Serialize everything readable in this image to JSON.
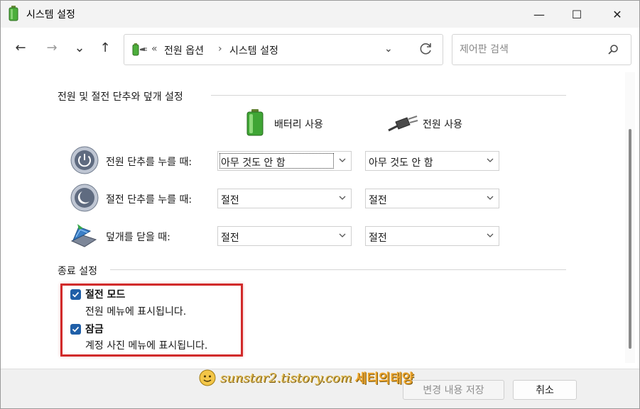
{
  "window": {
    "title": "시스템 설정",
    "minimize_glyph": "—",
    "maximize_glyph": "☐",
    "close_glyph": "✕"
  },
  "nav": {
    "back_glyph": "←",
    "forward_glyph": "→",
    "recent_glyph": "⌄",
    "up_glyph": "↑",
    "address": {
      "overflow": "«",
      "crumbs": [
        "전원 옵션",
        "시스템 설정"
      ],
      "separator": "›",
      "dropdown_glyph": "⌄"
    },
    "search": {
      "placeholder": "제어판 검색"
    }
  },
  "power_buttons_section": {
    "heading": "전원 및 절전 단추와 덮개 설정",
    "columns": {
      "battery": "배터리 사용",
      "plugged": "전원 사용"
    },
    "rows": [
      {
        "label": "전원 단추를 누를 때:",
        "battery": "아무 것도 안 함",
        "plugged": "아무 것도 안 함",
        "icon": "power-button-icon"
      },
      {
        "label": "절전 단추를 누를 때:",
        "battery": "절전",
        "plugged": "절전",
        "icon": "sleep-button-icon"
      },
      {
        "label": "덮개를 닫을 때:",
        "battery": "절전",
        "plugged": "절전",
        "icon": "laptop-lid-icon"
      }
    ]
  },
  "shutdown_section": {
    "heading": "종료 설정",
    "items": [
      {
        "title": "절전 모드",
        "desc": "전원 메뉴에 표시됩니다.",
        "checked": true
      },
      {
        "title": "잠금",
        "desc": "계정 사진 메뉴에 표시됩니다.",
        "checked": true
      }
    ]
  },
  "footer": {
    "save_label": "변경 내용 저장",
    "cancel_label": "취소"
  },
  "watermark": {
    "url": "sunstar2.tistory.com",
    "name": "세티의태양"
  },
  "colors": {
    "accent": "#1f5fa8",
    "highlight": "#d12a2a"
  }
}
